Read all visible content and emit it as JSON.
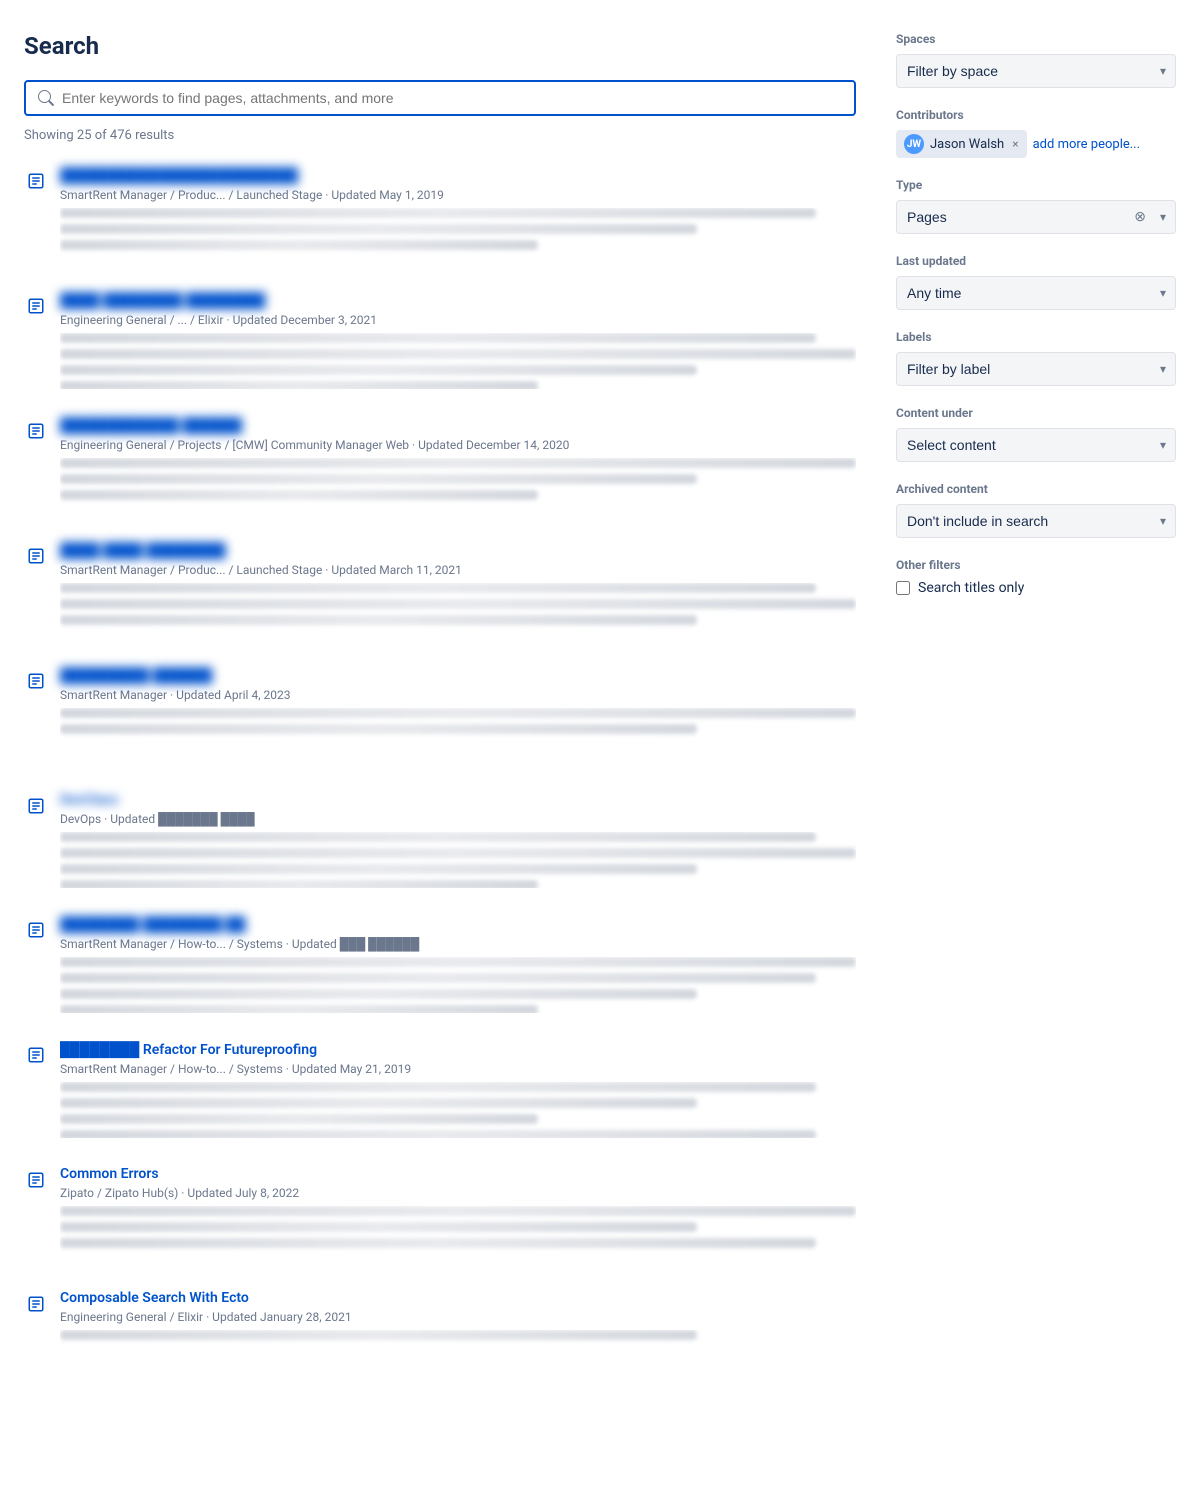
{
  "page": {
    "title": "Search"
  },
  "search": {
    "placeholder": "Enter keywords to find pages, attachments, and more",
    "value": ""
  },
  "results": {
    "showing": "Showing 25 of 476 results"
  },
  "items": [
    {
      "id": 1,
      "title": "████████████████████████",
      "title_visible": false,
      "meta": "SmartRent Manager / Produc... / Launched Stage · Updated May 1, 2019",
      "snippet_lines": [
        "long",
        "medium",
        "short"
      ]
    },
    {
      "id": 2,
      "title": "████ ████████ ████████",
      "title_visible": false,
      "meta": "Engineering General / ... / Elixir · Updated December 3, 2021",
      "snippet_lines": [
        "long",
        "full",
        "medium",
        "short"
      ]
    },
    {
      "id": 3,
      "title": "████████████ ██████",
      "title_visible": false,
      "meta": "Engineering General / Projects / [CMW] Community Manager Web · Updated December 14, 2020",
      "snippet_lines": [
        "full",
        "medium",
        "short"
      ]
    },
    {
      "id": 4,
      "title": "████ ████ ████████",
      "title_visible": false,
      "meta": "SmartRent Manager / Produc... / Launched Stage · Updated March 11, 2021",
      "snippet_lines": [
        "long",
        "full",
        "medium"
      ]
    },
    {
      "id": 5,
      "title": "█████████ ██████",
      "title_visible": false,
      "meta": "SmartRent Manager · Updated April 4, 2023",
      "snippet_lines": [
        "full",
        "medium"
      ]
    },
    {
      "id": 6,
      "title": "DevClass",
      "title_visible": false,
      "meta": "DevOps · Updated ███████ ████",
      "snippet_lines": [
        "long",
        "full",
        "medium",
        "short"
      ]
    },
    {
      "id": 7,
      "title": "████████ ████████ ██",
      "title_visible": false,
      "meta": "SmartRent Manager / How-to... / Systems · Updated ███ ██████",
      "snippet_lines": [
        "full",
        "long",
        "medium",
        "short"
      ]
    },
    {
      "id": 8,
      "title": "████████ Refactor For Futureproofing",
      "title_visible": true,
      "meta": "SmartRent Manager / How-to... / Systems · Updated May 21, 2019",
      "snippet_lines": [
        "long",
        "medium",
        "short",
        "long"
      ]
    },
    {
      "id": 9,
      "title": "Common Errors",
      "title_visible": true,
      "meta": "Zipato / Zipato Hub(s) · Updated July 8, 2022",
      "snippet_lines": [
        "full",
        "medium",
        "long"
      ]
    },
    {
      "id": 10,
      "title": "Composable Search With Ecto",
      "title_visible": true,
      "meta": "Engineering General / Elixir · Updated January 28, 2021",
      "snippet_lines": [
        "medium"
      ]
    }
  ],
  "sidebar": {
    "spaces_label": "Spaces",
    "spaces_placeholder": "Filter by space",
    "contributors_label": "Contributors",
    "contributor_name": "Jason Walsh",
    "add_people_label": "add more people...",
    "type_label": "Type",
    "type_value": "Pages",
    "last_updated_label": "Last updated",
    "last_updated_value": "Any time",
    "labels_label": "Labels",
    "labels_placeholder": "Filter by label",
    "content_under_label": "Content under",
    "content_under_placeholder": "Select content",
    "archived_label": "Archived content",
    "archived_value": "Don't include in search",
    "other_filters_label": "Other filters",
    "search_titles_label": "Search titles only"
  }
}
